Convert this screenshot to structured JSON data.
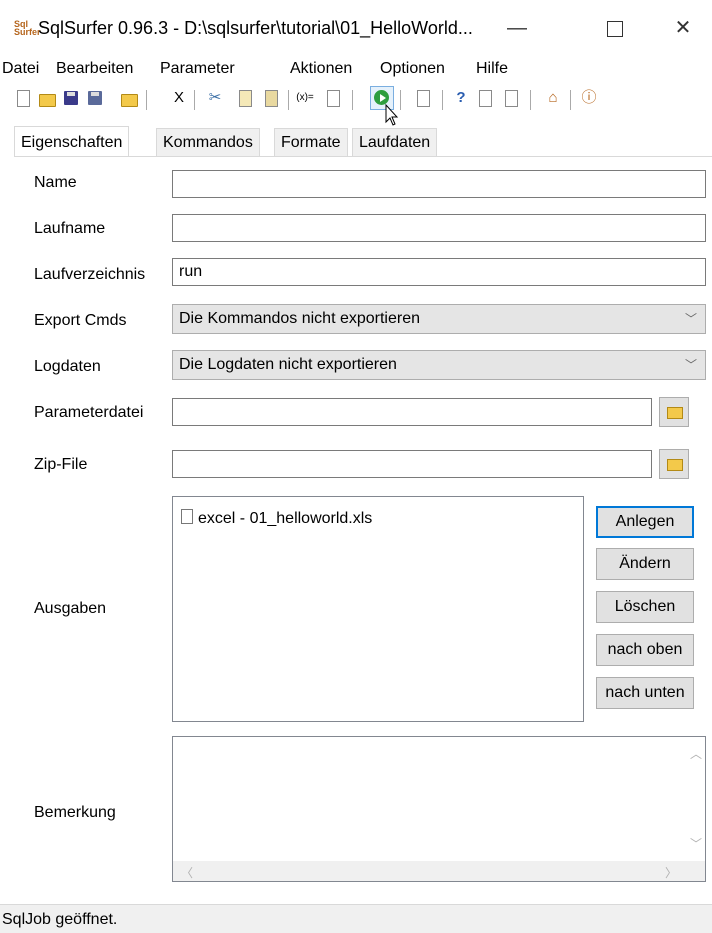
{
  "window": {
    "title": "SqlSurfer 0.96.3 - D:\\sqlsurfer\\tutorial\\01_HelloWorld...",
    "icon_text": "Sql Surfer"
  },
  "menu": [
    "Datei",
    "Bearbeiten",
    "Parameter",
    "Aktionen",
    "Optionen",
    "Hilfe"
  ],
  "tabs": [
    "Eigenschaften",
    "Kommandos",
    "Formate",
    "Laufdaten"
  ],
  "form": {
    "name": {
      "label": "Name",
      "value": ""
    },
    "laufname": {
      "label": "Laufname",
      "value": ""
    },
    "laufverzeichnis": {
      "label": "Laufverzeichnis",
      "value": "run"
    },
    "export_cmds": {
      "label": "Export Cmds",
      "value": "Die Kommandos nicht exportieren"
    },
    "logdaten": {
      "label": "Logdaten",
      "value": "Die Logdaten nicht exportieren"
    },
    "parameterdatei": {
      "label": "Parameterdatei",
      "value": ""
    },
    "zip_file": {
      "label": "Zip-File",
      "value": ""
    },
    "ausgaben": {
      "label": "Ausgaben",
      "items": [
        "excel - 01_helloworld.xls"
      ],
      "buttons": [
        "Anlegen",
        "Ändern",
        "Löschen",
        "nach oben",
        "nach unten"
      ]
    },
    "bemerkung": {
      "label": "Bemerkung",
      "value": ""
    }
  },
  "toolbar_icons": [
    "new-icon",
    "open-folder-icon",
    "save-icon",
    "save-as-icon",
    "folder-icon",
    "delete-icon",
    "cut-icon",
    "copy-icon",
    "paste-icon",
    "variable-icon",
    "export-icon",
    "run-icon",
    "properties-icon",
    "help-icon",
    "doc-icon",
    "doc2-icon",
    "home-icon",
    "info-icon"
  ],
  "toolbar_text": {
    "delete": "X",
    "variable": "(x)=",
    "help": "?"
  },
  "status": {
    "text": "SqlJob geöffnet."
  },
  "colors": {
    "focus_border": "#0078d7",
    "run_green": "#2e9e3e",
    "select_bg": "#e5e5e5"
  }
}
